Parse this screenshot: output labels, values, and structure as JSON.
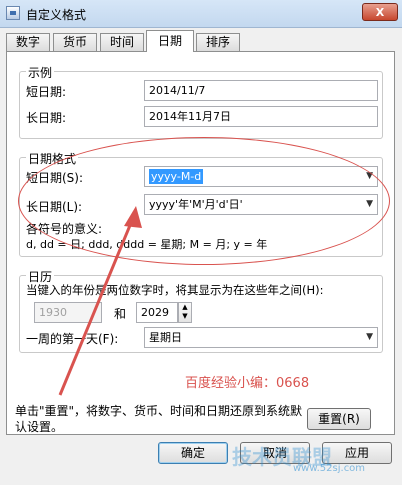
{
  "window": {
    "title": "自定义格式",
    "close_label": "X"
  },
  "tabs": [
    {
      "label": "数字"
    },
    {
      "label": "货币"
    },
    {
      "label": "时间"
    },
    {
      "label": "日期",
      "active": true
    },
    {
      "label": "排序"
    }
  ],
  "example": {
    "title": "示例",
    "short_label": "短日期:",
    "short_value": "2014/11/7",
    "long_label": "长日期:",
    "long_value": "2014年11月7日"
  },
  "date_format": {
    "title": "日期格式",
    "short_label": "短日期(S):",
    "short_value": "yyyy-M-d",
    "long_label": "长日期(L):",
    "long_value": "yyyy'年'M'月'd'日'",
    "meaning_title": "各符号的意义:",
    "meaning_text": "d, dd = 日;  ddd, dddd = 星期;  M = 月;  y = 年"
  },
  "calendar": {
    "title": "日历",
    "two_digit_label": "当键入的年份是两位数字时，将其显示为在这些年之间(H):",
    "year_from": "1930",
    "and_label": "和",
    "year_to": "2029",
    "first_day_label": "一周的第一天(F):",
    "first_day_value": "星期日"
  },
  "annotation": {
    "text": "百度经验小编：0668",
    "color": "#d9534f"
  },
  "reset": {
    "description": "单击\"重置\"，将数字、货币、时间和日期还原到系统默认设置。",
    "button_label": "重置(R)"
  },
  "footer": {
    "ok_label": "确定",
    "cancel_label": "取消",
    "apply_label": "应用"
  },
  "watermark": {
    "text": "技术员联盟",
    "url": "www.52sj.com"
  }
}
